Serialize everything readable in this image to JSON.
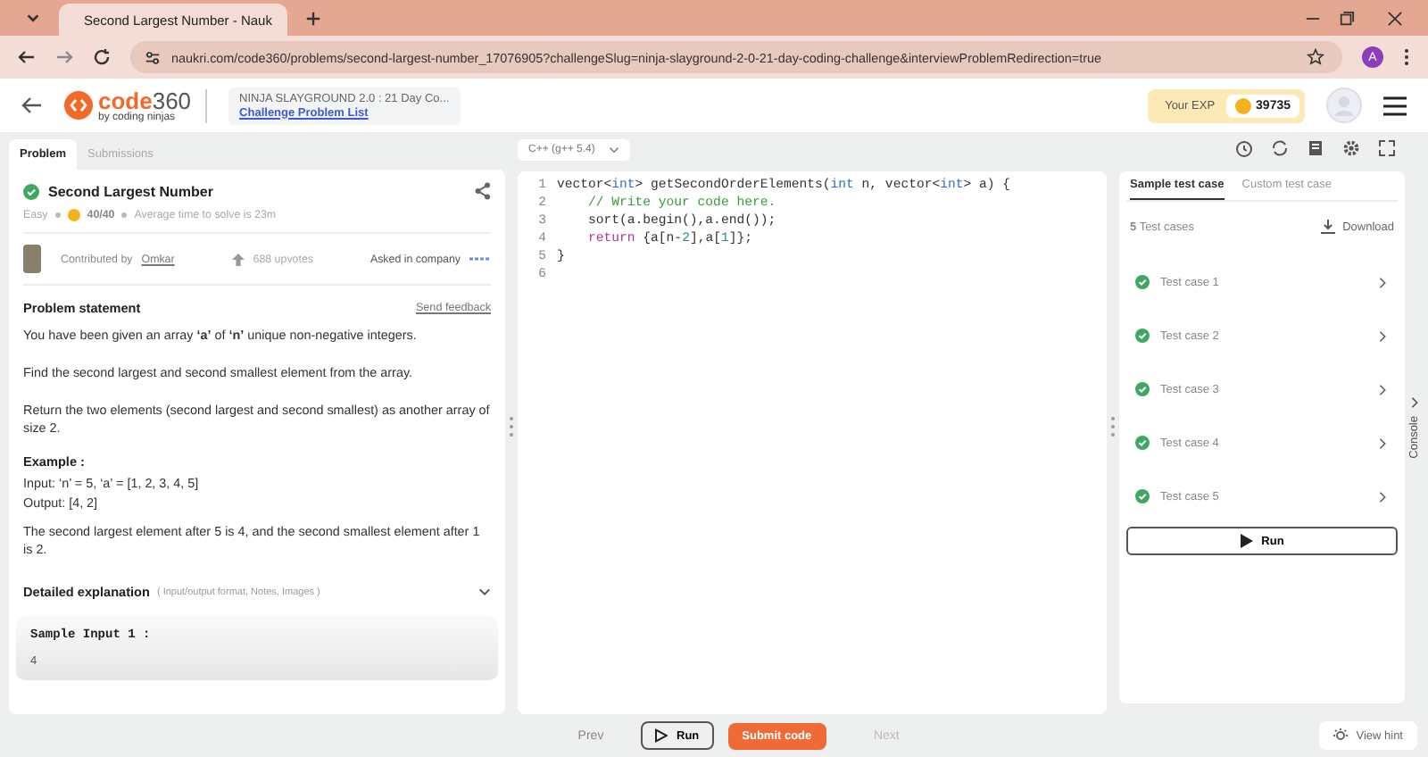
{
  "browser": {
    "tab_title": "Second Largest Number - Nauk",
    "url": "naukri.com/code360/problems/second-largest-number_17076905?challengeSlug=ninja-slayground-2-0-21-day-coding-challenge&interviewProblemRedirection=true",
    "profile": "A"
  },
  "header": {
    "logo": "code",
    "logo_number": "360",
    "logo_sub": "by coding ninjas",
    "challenge_title": "NINJA SLAYGROUND 2.0 : 21 Day Co...",
    "challenge_link": "Challenge Problem List",
    "exp_label": "Your EXP",
    "exp_value": "39735"
  },
  "tabs": [
    {
      "label": "Problem",
      "selected": true
    },
    {
      "label": "Submissions",
      "selected": false
    }
  ],
  "language": "C++ (g++ 5.4)",
  "problem": {
    "title": "Second Largest Number",
    "solved": true,
    "difficulty": "Easy",
    "score": "40/40",
    "avg_time": "Average time to solve is 23m",
    "contributed_by": "Contributed by",
    "author": "Omkar",
    "upvotes": "688 upvotes",
    "asked": "Asked in company",
    "statement_heading": "Problem statement",
    "feedback": "Send feedback",
    "paragraphs": [
      "You have been given an array **‘a’** of **‘n’** unique non-negative integers.",
      "Find the second largest and second smallest element from the array.",
      "Return the two elements (second largest and second smallest) as another array of size 2."
    ],
    "example_heading": "Example :",
    "example_lines": [
      "Input: ‘n’ = 5, ‘a’ = [1, 2, 3, 4, 5]",
      "Output: [4, 2]"
    ],
    "example_note": "The second largest element after 5 is 4, and the second smallest element after 1 is 2.",
    "detail_heading": "Detailed explanation",
    "detail_hint": "( Input/output format, Notes, Images )",
    "expanded": false,
    "sample_heading": "Sample Input 1 :",
    "sample_value": "4"
  },
  "editor": {
    "lines": [
      {
        "number": "1",
        "tokens": [
          {
            "kind": "plain",
            "text": "vector<"
          },
          {
            "kind": "type",
            "text": "int"
          },
          {
            "kind": "plain",
            "text": "> getSecondOrderElements("
          },
          {
            "kind": "type",
            "text": "int"
          },
          {
            "kind": "plain",
            "text": " n, vector<"
          },
          {
            "kind": "type",
            "text": "int"
          },
          {
            "kind": "plain",
            "text": "> a) {"
          }
        ]
      },
      {
        "number": "2",
        "indented": true,
        "tokens": [
          {
            "kind": "comment",
            "text": "// Write your code here."
          }
        ]
      },
      {
        "number": "3",
        "indented": true,
        "tokens": [
          {
            "kind": "plain",
            "text": "sort(a.begin(),a.end());"
          }
        ]
      },
      {
        "number": "4",
        "indented": true,
        "tokens": [
          {
            "kind": "keyword",
            "text": "return"
          },
          {
            "kind": "plain",
            "text": " {a[n-"
          },
          {
            "kind": "number",
            "text": "2"
          },
          {
            "kind": "plain",
            "text": "],a["
          },
          {
            "kind": "number",
            "text": "1"
          },
          {
            "kind": "plain",
            "text": "]};"
          }
        ]
      },
      {
        "number": "5",
        "tokens": [
          {
            "kind": "plain",
            "text": "}"
          }
        ]
      },
      {
        "number": "6"
      }
    ]
  },
  "tests": {
    "tabs": [
      {
        "label": "Sample test case",
        "selected": true
      },
      {
        "label": "Custom test case",
        "selected": false
      }
    ],
    "count": "**5** Test cases",
    "download": "Download",
    "cases": [
      {
        "label": "Test case 1",
        "passed": true
      },
      {
        "label": "Test case 2",
        "passed": true
      },
      {
        "label": "Test case 3",
        "passed": true
      },
      {
        "label": "Test case 4",
        "passed": true
      },
      {
        "label": "Test case 5",
        "passed": true
      }
    ],
    "run": "Run",
    "console": "Console"
  },
  "footer": {
    "prev": "Prev",
    "run": "Run",
    "submit": "Submit code",
    "next": "Next",
    "hint": "View hint"
  }
}
